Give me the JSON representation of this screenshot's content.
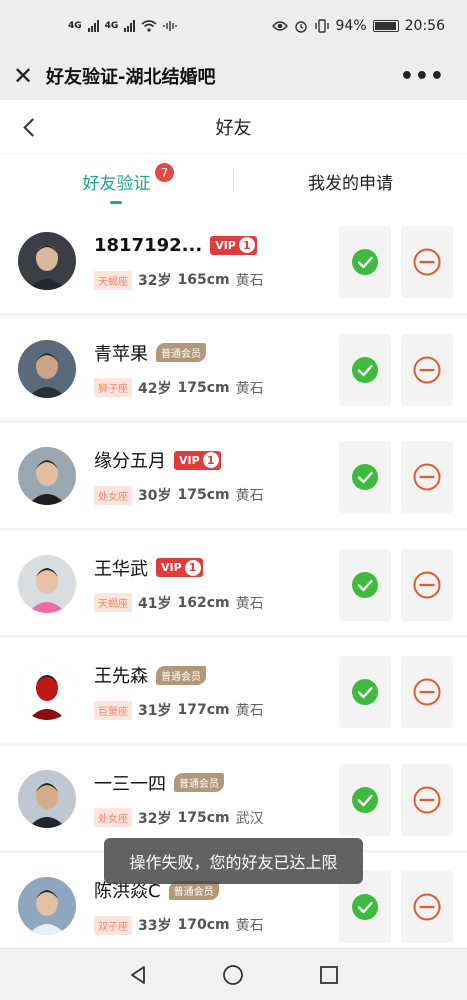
{
  "status_bar": {
    "net1": "4G",
    "net2": "4G",
    "battery": "94%",
    "time": "20:56"
  },
  "topbar": {
    "title": "好友验证-湖北结婚吧",
    "more": "•••"
  },
  "page": {
    "title": "好友"
  },
  "tabs": [
    {
      "label": "好友验证",
      "count": "7"
    },
    {
      "label": "我发的申请"
    }
  ],
  "requests": [
    {
      "name": "1817192...",
      "badge": "vip",
      "vip_label": "VIP",
      "vip_level": "1",
      "sign": "天蝎座",
      "age": "32岁",
      "height": "165cm",
      "city": "黄石",
      "name_bold": true
    },
    {
      "name": "青苹果",
      "badge": "member",
      "member_label": "普通会员",
      "sign": "狮子座",
      "age": "42岁",
      "height": "175cm",
      "city": "黄石"
    },
    {
      "name": "缘分五月",
      "badge": "vip",
      "vip_label": "VIP",
      "vip_level": "1",
      "sign": "处女座",
      "age": "30岁",
      "height": "175cm",
      "city": "黄石"
    },
    {
      "name": "王华武",
      "badge": "vip",
      "vip_label": "VIP",
      "vip_level": "1",
      "sign": "天蝎座",
      "age": "41岁",
      "height": "162cm",
      "city": "黄石"
    },
    {
      "name": "王先森",
      "badge": "member",
      "member_label": "普通会员",
      "sign": "巨蟹座",
      "age": "31岁",
      "height": "177cm",
      "city": "黄石"
    },
    {
      "name": "一三一四",
      "badge": "member",
      "member_label": "普通会员",
      "sign": "处女座",
      "age": "32岁",
      "height": "175cm",
      "city": "武汉"
    },
    {
      "name": "陈洪焱C",
      "badge": "member",
      "member_label": "普通会员",
      "sign": "双子座",
      "age": "33岁",
      "height": "170cm",
      "city": "黄石"
    }
  ],
  "toast": "操作失败，您的好友已达上限",
  "colors": {
    "accent": "#1aa68d",
    "accept": "#3dbb3d",
    "reject": "#e8572f",
    "vip": "#e23b3b",
    "member": "#b29778"
  }
}
